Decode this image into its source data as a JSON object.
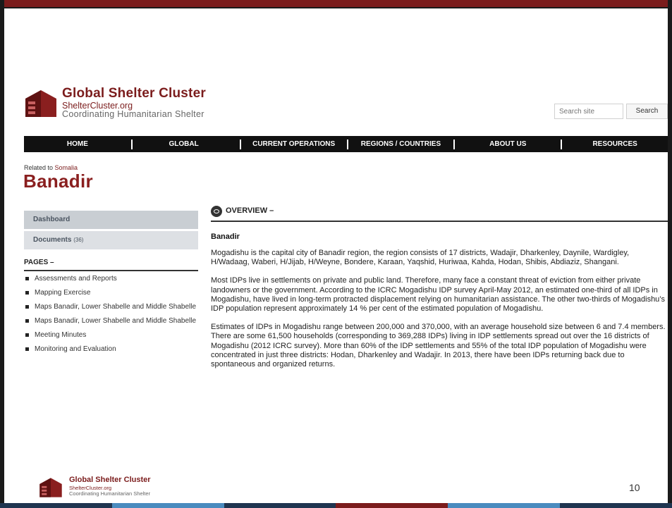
{
  "header": {
    "logo_title": "Global Shelter Cluster",
    "logo_url": "ShelterCluster.org",
    "logo_subtitle": "Coordinating Humanitarian Shelter",
    "search_placeholder": "Search site",
    "search_button": "Search"
  },
  "nav": [
    "HOME",
    "GLOBAL",
    "CURRENT OPERATIONS",
    "REGIONS / COUNTRIES",
    "ABOUT US",
    "RESOURCES"
  ],
  "title_area": {
    "related_prefix": "Related to",
    "related_link": "Somalia",
    "page_title": "Banadir"
  },
  "sidebar": {
    "dashboard": "Dashboard",
    "documents": "Documents",
    "documents_count": "(36)",
    "pages_heading": "PAGES –",
    "pages": [
      "Assessments and Reports",
      "Mapping Exercise",
      "Maps Banadir, Lower Shabelle and Middle Shabelle",
      "Maps Banadir, Lower Shabelle and Middle Shabelle",
      "Meeting Minutes",
      "Monitoring and Evaluation"
    ]
  },
  "overview": {
    "heading": "OVERVIEW –",
    "subheading": "Banadir",
    "paragraphs": [
      "Mogadishu is the capital city of Banadir region, the region consists of 17 districts, Wadajir, Dharkenley, Daynile, Wardigley, H/Wadaag, Waberi, H/Jijab, H/Weyne, Bondere, Karaan, Yaqshid, Huriwaa, Kahda, Hodan, Shibis, Abdiaziz, Shangani.",
      "Most IDPs live in settlements on private and public land. Therefore, many face a constant threat of eviction from either private landowners or the government. According to the ICRC Mogadishu IDP survey April-May 2012, an estimated one-third of all IDPs in Mogadishu, have lived in long-term protracted displacement relying on humanitarian assistance. The other two-thirds of Mogadishu’s IDP population represent approximately 14 % per cent of the estimated population of Mogadishu.",
      "Estimates of IDPs in Mogadishu range between 200,000 and 370,000, with an average household size between 6 and 7.4 members. There are some 61,500 households (corresponding to 369,288 IDPs) living in IDP settlements spread out over the 16 districts of Mogadishu (2012 ICRC survey). More than 60% of the IDP settlements and 55% of the total IDP population of Mogadishu were concentrated in just three districts: Hodan, Dharkenley and Wadajir. In 2013, there have been IDPs returning back due to spontaneous and organized returns."
    ]
  },
  "footer": {
    "logo_title": "Global Shelter Cluster",
    "logo_url": "ShelterCluster.org",
    "logo_subtitle": "Coordinating Humanitarian Shelter",
    "page_number": "10"
  },
  "colors": {
    "brand": "#7b1c1c",
    "nav_bg": "#111111",
    "bottom_bar": [
      "#1f3550",
      "#4a8bbf",
      "#1f3550",
      "#7b1c1c",
      "#4a8bbf",
      "#1f3550"
    ]
  }
}
